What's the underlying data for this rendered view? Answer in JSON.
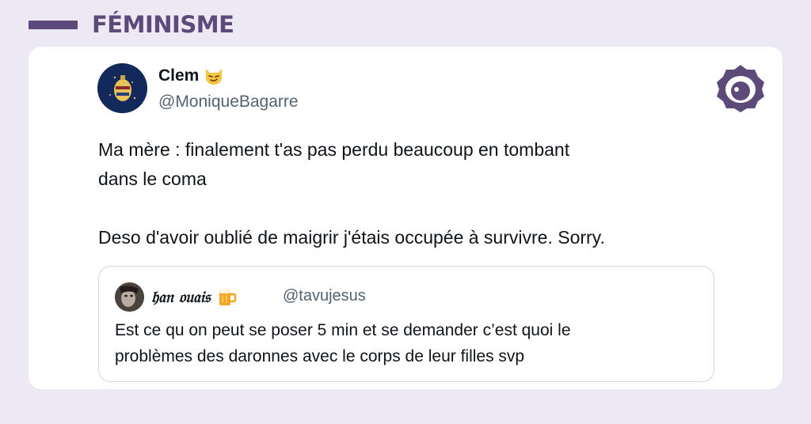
{
  "category": {
    "label": "FÉMINISME"
  },
  "tweet": {
    "author_name": "Clem",
    "author_handle": "@MoniqueBagarre",
    "author_emoji": "smirking-cat-icon",
    "lines": [
      "Ma mère : finalement t'as pas perdu beaucoup en tombant",
      "dans le coma",
      "Deso d'avoir oublié de maigrir j'étais occupée à survivre. Sorry."
    ]
  },
  "quoted_tweet": {
    "author_name": "𝔥𝔞𝔫 𝔬𝔲𝔞𝔦𝔰",
    "author_emoji": "beer-mug-icon",
    "author_handle": "@tavujesus",
    "lines": [
      "Est ce qu on peut se poser 5 min et se demander c’est quoi le",
      "problèmes des daronnes avec le corps de leur filles svp"
    ]
  },
  "colors": {
    "page_background": "#ece8f4",
    "accent": "#5b4a7a",
    "card_background": "#ffffff",
    "text_primary": "#0f1419",
    "text_secondary": "#536471",
    "quote_border": "#cfd9de"
  }
}
